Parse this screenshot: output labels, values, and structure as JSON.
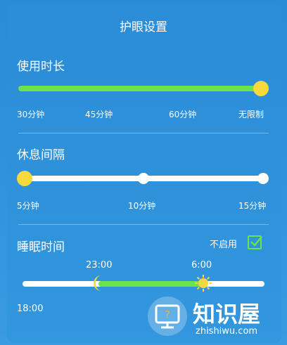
{
  "header": {
    "title": "护眼设置"
  },
  "usage": {
    "label": "使用时长",
    "ticks": [
      "30分钟",
      "45分钟",
      "60分钟",
      "无限制"
    ],
    "value": "无限制",
    "fill_fraction": 1.0
  },
  "break": {
    "label": "休息间隔",
    "ticks": [
      "5分钟",
      "10分钟",
      "15分钟"
    ],
    "value": "5分钟"
  },
  "sleep": {
    "label": "睡眠时间",
    "toggle_label": "不启用",
    "checked": true,
    "start_time": "23:00",
    "end_time": "6:00",
    "range_start_label": "18:00",
    "start_icon": "moon-icon",
    "end_icon": "sun-icon"
  },
  "watermark": {
    "name": "知识屋",
    "url": "zhishiwu.com"
  },
  "colors": {
    "accent": "#6be34a",
    "knob": "#f6d93c",
    "background": "#2f92dd"
  }
}
